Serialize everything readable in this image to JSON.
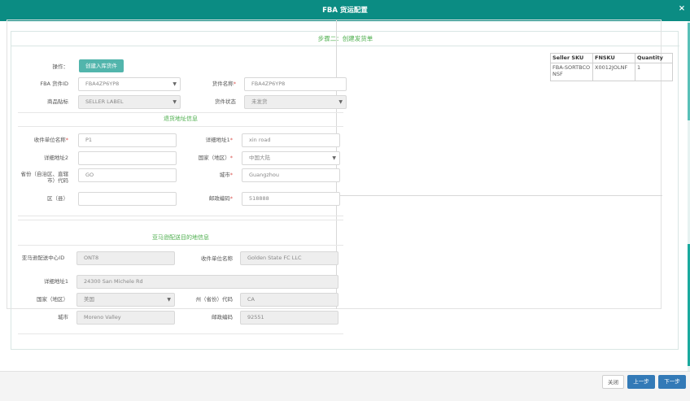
{
  "modal": {
    "title": "FBA 货运配置",
    "close_icon": "×"
  },
  "step_title": "步骤二：创建发货单",
  "top_form": {
    "operation_label": "操作：",
    "create_button": "创建入库货件",
    "fba_id_label": "FBA 货件ID",
    "fba_id_value": "FBA4ZP6YP8",
    "shipment_name_label": "货件名称",
    "shipment_name_value": "FBA4ZP6YP8",
    "label_owner_label": "商品贴标",
    "label_owner_value": "SELLER LABEL",
    "shipment_status_label": "货件状态",
    "shipment_status_value": "未发货"
  },
  "return_section": {
    "title": "退货地址信息",
    "recipient_label": "收件单位名称",
    "recipient_value": "P1",
    "address1_label": "详细地址1",
    "address1_value": "xin road",
    "address2_label": "详细地址2",
    "address2_value": "",
    "country_label": "国家（地区）",
    "country_value": "中国大陆",
    "province_label": "省份（自治区、直辖市）代码",
    "province_value": "GO",
    "city_label": "城市",
    "city_value": "Guangzhou",
    "district_label": "区（县）",
    "district_value": "",
    "postal_label": "邮政编码",
    "postal_value": "518888"
  },
  "amazon_section": {
    "title": "亚马逊配送目的地信息",
    "center_id_label": "亚马逊配送中心ID",
    "center_id_value": "ONT8",
    "recipient_label": "收件单位名称",
    "recipient_value": "Golden State FC LLC",
    "address1_label": "详细地址1",
    "address1_value": "24300 San Michele Rd",
    "country_label": "国家（地区）",
    "country_value": "美国",
    "state_label": "州（省份）代码",
    "state_value": "CA",
    "city_label": "城市",
    "city_value": "Moreno Valley",
    "postal_label": "邮政编码",
    "postal_value": "92551"
  },
  "sku_table": {
    "headers": [
      "Seller SKU",
      "FNSKU",
      "Quantity"
    ],
    "rows": [
      {
        "seller_sku": "FBA-SORTBCONSF",
        "fnsku": "X0012JOLNF",
        "quantity": "1"
      }
    ]
  },
  "footer": {
    "close": "关闭",
    "prev": "上一步",
    "next": "下一步"
  },
  "colors": {
    "header": "#0b8c83",
    "accent": "#52b5ac",
    "primary_button": "#337ab7",
    "section_title": "#4cae4c",
    "required": "#d9534f"
  }
}
